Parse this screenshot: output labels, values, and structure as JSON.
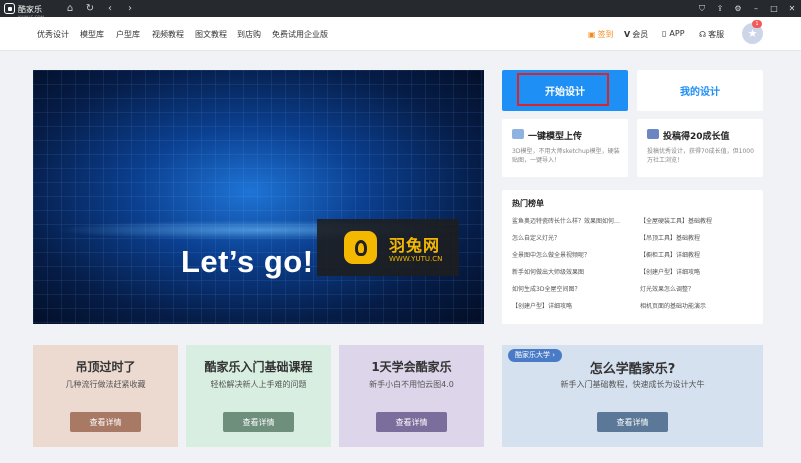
{
  "titlebar": {
    "app_name": "酷家乐",
    "app_sub": "KUJIALE.COM",
    "home_icon": "home-icon",
    "refresh_icon": "refresh-icon",
    "back_icon": "chevron-left-icon",
    "forward_icon": "chevron-right-icon",
    "right_icons": [
      "tshirt-icon",
      "share-icon",
      "gear-icon",
      "minimize-icon",
      "maximize-icon",
      "close-icon"
    ]
  },
  "nav": {
    "links": [
      "优秀设计",
      "模型库",
      "户型库",
      "视频教程",
      "图文教程",
      "到店购",
      "免费试用企业版"
    ],
    "checkin": "签到",
    "vip": "会员",
    "app": "APP",
    "service": "客服",
    "notification_count": "1"
  },
  "banner": {
    "headline": "Let’s go!",
    "watermark_cn": "羽兔网",
    "watermark_en": "WWW.YUTU.CN"
  },
  "actions": {
    "start_design": "开始设计",
    "my_design": "我的设计"
  },
  "features": [
    {
      "title": "一键模型上传",
      "desc": "3D模型，不用大师sketchup模型，硬装贴图，一键导入！",
      "color": "#8fb3e0"
    },
    {
      "title": "投稿得20成长值",
      "desc": "投稿优秀设计，获得70成长值，但1000万社工浏览！",
      "color": "#6c86c2"
    }
  ],
  "hot": {
    "title": "热门榜单",
    "left": [
      "鲨鱼奥迈特瓷砖长什么样？效果图如何…",
      "怎么自定义灯光？",
      "全景图中怎么做全景视频呢？",
      "新手如何做出大师级效果图",
      "如何生成3D全屋空间图？",
      "【创建户型】详细攻略"
    ],
    "right": [
      "【全屋硬装工具】基础教程",
      "【吊顶工具】基础教程",
      "【橱柜工具】详细教程",
      "【创建户型】详细攻略",
      "灯光效果怎么调整？",
      "相机页面的基础功能演示"
    ]
  },
  "promos": [
    {
      "title": "吊顶过时了",
      "subtitle": "几种流行做法赶紧收藏",
      "button": "查看详情",
      "bg": "#ecd9d0",
      "btn": "#a87a66"
    },
    {
      "title": "酷家乐入门基础课程",
      "subtitle": "轻松解决新人上手难的问题",
      "button": "查看详情",
      "bg": "#d7eee0",
      "btn": "#6d8f7c"
    },
    {
      "title": "1天学会酷家乐",
      "subtitle": "新手小白不用怕云图4.0",
      "button": "查看详情",
      "bg": "#ddd6ea",
      "btn": "#7b6e9d"
    },
    {
      "title": "怎么学酷家乐?",
      "subtitle": "新手入门基础教程，快速成长为设计大牛",
      "button": "查看详情",
      "bg": "#d5e1ef",
      "btn": "#5b7898",
      "tag": "酷家乐大学 ›"
    }
  ],
  "colors": {
    "accent": "#1e8ff5",
    "checkin": "#f58a1f",
    "highlight": "#d8262a"
  }
}
